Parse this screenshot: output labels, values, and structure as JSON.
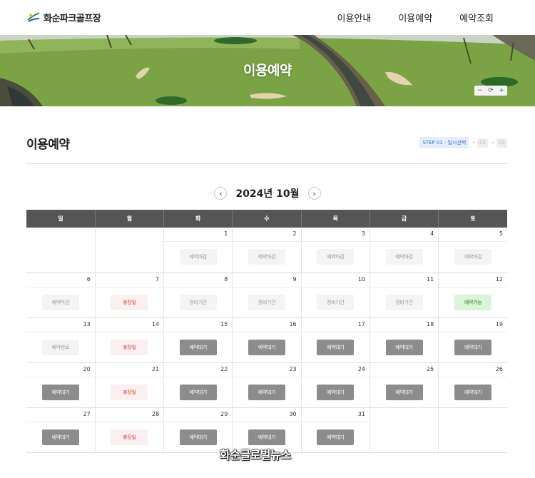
{
  "header": {
    "brand": "화순파크골프장",
    "nav": [
      "이용안내",
      "이용예약",
      "예약조회"
    ]
  },
  "hero": {
    "title": "이용예약",
    "zoom": {
      "minus": "−",
      "reset": "⟳",
      "plus": "+"
    }
  },
  "section": {
    "title": "이용예약",
    "steps": {
      "active": "STEP 01 · 일시선택",
      "step2": "02",
      "step3": "03",
      "separator": "→"
    }
  },
  "calendar": {
    "month_label": "2024년 10월",
    "prev_icon": "‹",
    "next_icon": "›",
    "weekdays": [
      "일",
      "월",
      "화",
      "수",
      "목",
      "금",
      "토"
    ],
    "status_labels": {
      "closed": "예약마감",
      "holiday": "휴장일",
      "maint": "정비기간",
      "available": "예약가능",
      "done": "예약완료",
      "wait": "예약대기"
    },
    "weeks": [
      [
        null,
        null,
        {
          "day": "1",
          "status": "closed"
        },
        {
          "day": "2",
          "status": "closed"
        },
        {
          "day": "3",
          "status": "closed"
        },
        {
          "day": "4",
          "status": "closed"
        },
        {
          "day": "5",
          "status": "closed"
        }
      ],
      [
        {
          "day": "6",
          "status": "closed"
        },
        {
          "day": "7",
          "status": "holiday"
        },
        {
          "day": "8",
          "status": "maint"
        },
        {
          "day": "9",
          "status": "maint"
        },
        {
          "day": "10",
          "status": "maint"
        },
        {
          "day": "11",
          "status": "maint"
        },
        {
          "day": "12",
          "status": "available"
        }
      ],
      [
        {
          "day": "13",
          "status": "done"
        },
        {
          "day": "14",
          "status": "holiday"
        },
        {
          "day": "15",
          "status": "wait"
        },
        {
          "day": "16",
          "status": "wait"
        },
        {
          "day": "17",
          "status": "wait"
        },
        {
          "day": "18",
          "status": "wait"
        },
        {
          "day": "19",
          "status": "wait"
        }
      ],
      [
        {
          "day": "20",
          "status": "wait"
        },
        {
          "day": "21",
          "status": "holiday"
        },
        {
          "day": "22",
          "status": "wait"
        },
        {
          "day": "23",
          "status": "wait"
        },
        {
          "day": "24",
          "status": "wait"
        },
        {
          "day": "25",
          "status": "wait"
        },
        {
          "day": "26",
          "status": "wait"
        }
      ],
      [
        {
          "day": "27",
          "status": "wait"
        },
        {
          "day": "28",
          "status": "holiday"
        },
        {
          "day": "29",
          "status": "wait"
        },
        {
          "day": "30",
          "status": "wait"
        },
        {
          "day": "31",
          "status": "wait"
        },
        null,
        null
      ]
    ]
  },
  "watermark": "화순글로벌뉴스",
  "colors": {
    "header_row": "#555555",
    "wait_badge": "#8c8c8c",
    "available_badge": "#d9f4d7",
    "holiday_text": "#d93a3a",
    "step_active_bg": "#e4eefc"
  }
}
